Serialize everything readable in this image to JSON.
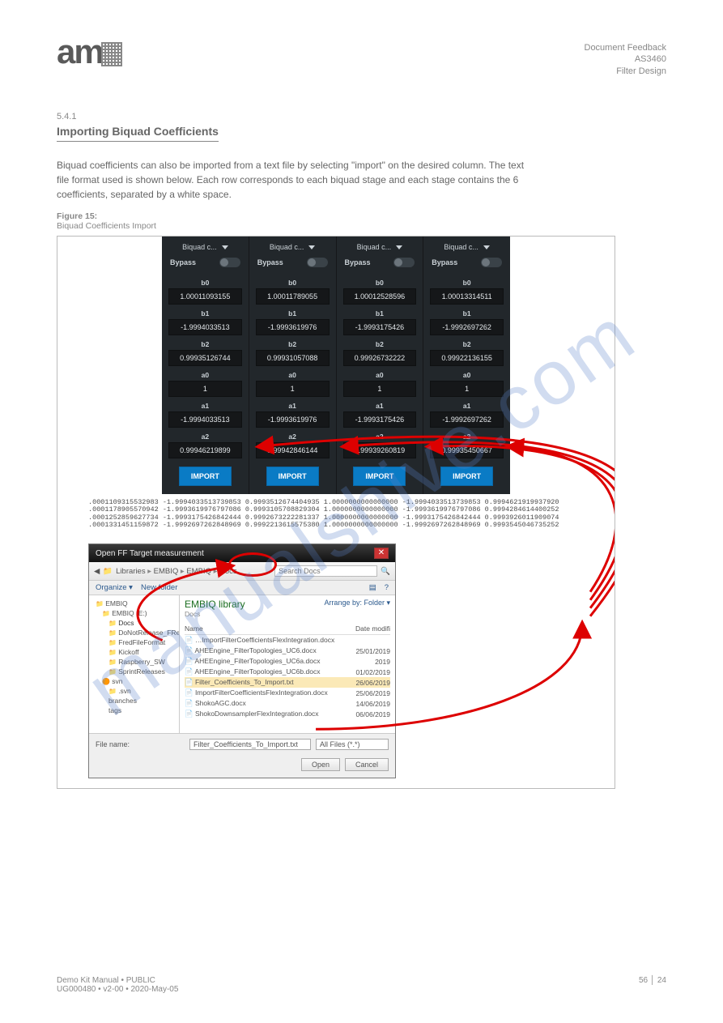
{
  "header": {
    "logo_text": "am",
    "right_line1": "Document Feedback",
    "right_line2": "AS3460",
    "right_line3": "Filter Design"
  },
  "section": {
    "label": "5.4.1",
    "title": "Importing Biquad Coefficients",
    "intro": "Biquad coefficients can also be imported from a text file by selecting \"import\" on the desired column. The text file format used is shown below. Each row corresponds to each biquad stage and each stage contains the 6 coefficients, separated by a white space."
  },
  "figure": {
    "caption": "Figure 15: Biquad Coefficients Import"
  },
  "biquad": {
    "dropdown": "Biquad c...",
    "bypass": "Bypass",
    "labels": [
      "b0",
      "b1",
      "b2",
      "a0",
      "a1",
      "a2"
    ],
    "cols": [
      {
        "b0": "1.00011093155",
        "b1": "-1.9994033513",
        "b2": "0.99935126744",
        "a0": "1",
        "a1": "-1.9994033513",
        "a2": "0.99946219899"
      },
      {
        "b0": "1.00011789055",
        "b1": "-1.9993619976",
        "b2": "0.99931057088",
        "a0": "1",
        "a1": "-1.9993619976",
        "a2": "0.99942846144"
      },
      {
        "b0": "1.00012528596",
        "b1": "-1.9993175426",
        "b2": "0.99926732222",
        "a0": "1",
        "a1": "-1.9993175426",
        "a2": "0.99939260819"
      },
      {
        "b0": "1.00013314511",
        "b1": "-1.9992697262",
        "b2": "0.99922136155",
        "a0": "1",
        "a1": "-1.9992697262",
        "a2": "0.99935450667"
      }
    ],
    "import_btn": "IMPORT"
  },
  "txtrows": [
    ".0001109315532983 -1.9994033513739853 0.9993512674404935 1.0000000000000000 -1.9994033513739853 0.9994621919937920",
    ".0001178905570942 -1.9993619976797086 0.9993105708829304 1.0000000000000000 -1.9993619976797086 0.9994284614400252",
    ".0001252859627734 -1.9993175426842444 0.9992673222281337 1.0000000000000000 -1.9993175426842444 0.9993926011909074",
    ".0001331451159872 -1.9992697262848969 0.9992213615575380 1.0000000000000000 -1.9992697262848969 0.9993545046735252"
  ],
  "dialog": {
    "title": "Open FF Target measurement",
    "crumb": [
      "Libraries",
      "EMBIQ",
      "EMBIQ",
      "Docs"
    ],
    "search_ph": "Search Docs",
    "organize": "Organize ▾",
    "newfolder": "New folder",
    "tree": [
      {
        "t": "fold",
        "l": "EMBIQ",
        "i": 0
      },
      {
        "t": "fold",
        "l": "EMBIQ (E:)",
        "i": 1
      },
      {
        "t": "fold",
        "l": "Docs",
        "i": 2,
        "sel": true
      },
      {
        "t": "fold",
        "l": "DoNotRelease_FReD_Pok",
        "i": 2
      },
      {
        "t": "fold",
        "l": "FredFileFormat",
        "i": 2
      },
      {
        "t": "fold",
        "l": "Kickoff",
        "i": 2
      },
      {
        "t": "fold",
        "l": "Raspberry_SW",
        "i": 2
      },
      {
        "t": "fold",
        "l": "SprintReleases",
        "i": 2
      },
      {
        "t": "svn",
        "l": "svn",
        "i": 1
      },
      {
        "t": "fold",
        "l": ".svn",
        "i": 2
      },
      {
        "t": "tag",
        "l": "branches",
        "i": 2
      },
      {
        "t": "tag",
        "l": "tags",
        "i": 2
      }
    ],
    "lib_header": "EMBIQ library",
    "lib_sub": "Docs",
    "arrange": "Arrange by:  Folder ▾",
    "cols": {
      "name": "Name",
      "date": "Date modifi"
    },
    "files": [
      {
        "n": "…ImportFilterCoefficientsFlexIntegration.docx",
        "d": ""
      },
      {
        "n": "AHEEngine_FilterTopologies_UC6.docx",
        "d": "25/01/2019"
      },
      {
        "n": "AHEEngine_FilterTopologies_UC6a.docx",
        "d": "2019"
      },
      {
        "n": "AHEEngine_FilterTopologies_UC6b.docx",
        "d": "01/02/2019"
      },
      {
        "n": "Filter_Coefficients_To_Import.txt",
        "d": "26/06/2019",
        "hl": true
      },
      {
        "n": "ImportFilterCoefficientsFlexIntegration.docx",
        "d": "25/06/2019"
      },
      {
        "n": "ShokoAGC.docx",
        "d": "14/06/2019"
      },
      {
        "n": "ShokoDownsamplerFlexIntegration.docx",
        "d": "06/06/2019"
      }
    ],
    "filename_lbl": "File name:",
    "filename_val": "Filter_Coefficients_To_Import.txt",
    "filter": "All Files (*.*)",
    "open": "Open",
    "cancel": "Cancel"
  },
  "watermark": "manualshive.com",
  "footer": {
    "left1": "Demo Kit Manual • PUBLIC",
    "left2": "UG000480 • v2-00 • 2020-May-05",
    "right1": "56 │ 24"
  }
}
